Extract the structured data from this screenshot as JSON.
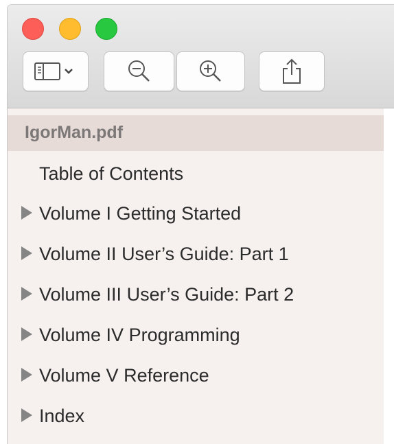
{
  "window": {
    "traffic_lights": [
      "close",
      "minimize",
      "zoom"
    ],
    "colors": {
      "close": "#fd5e57",
      "minimize": "#febc2e",
      "zoom": "#28c840"
    }
  },
  "toolbar": {
    "buttons": [
      {
        "icon": "sidebar-toggle-icon"
      },
      {
        "icon": "zoom-out-icon"
      },
      {
        "icon": "zoom-in-icon"
      },
      {
        "icon": "share-icon"
      }
    ]
  },
  "sidebar": {
    "file_name": "IgorMan.pdf",
    "items": [
      {
        "label": "Table of Contents",
        "expandable": false
      },
      {
        "label": "Volume I Getting Started",
        "expandable": true
      },
      {
        "label": "Volume II User’s Guide: Part 1",
        "expandable": true
      },
      {
        "label": "Volume III User’s Guide: Part 2",
        "expandable": true
      },
      {
        "label": "Volume IV Programming",
        "expandable": true
      },
      {
        "label": "Volume V Reference",
        "expandable": true
      },
      {
        "label": "Index",
        "expandable": true
      }
    ]
  }
}
